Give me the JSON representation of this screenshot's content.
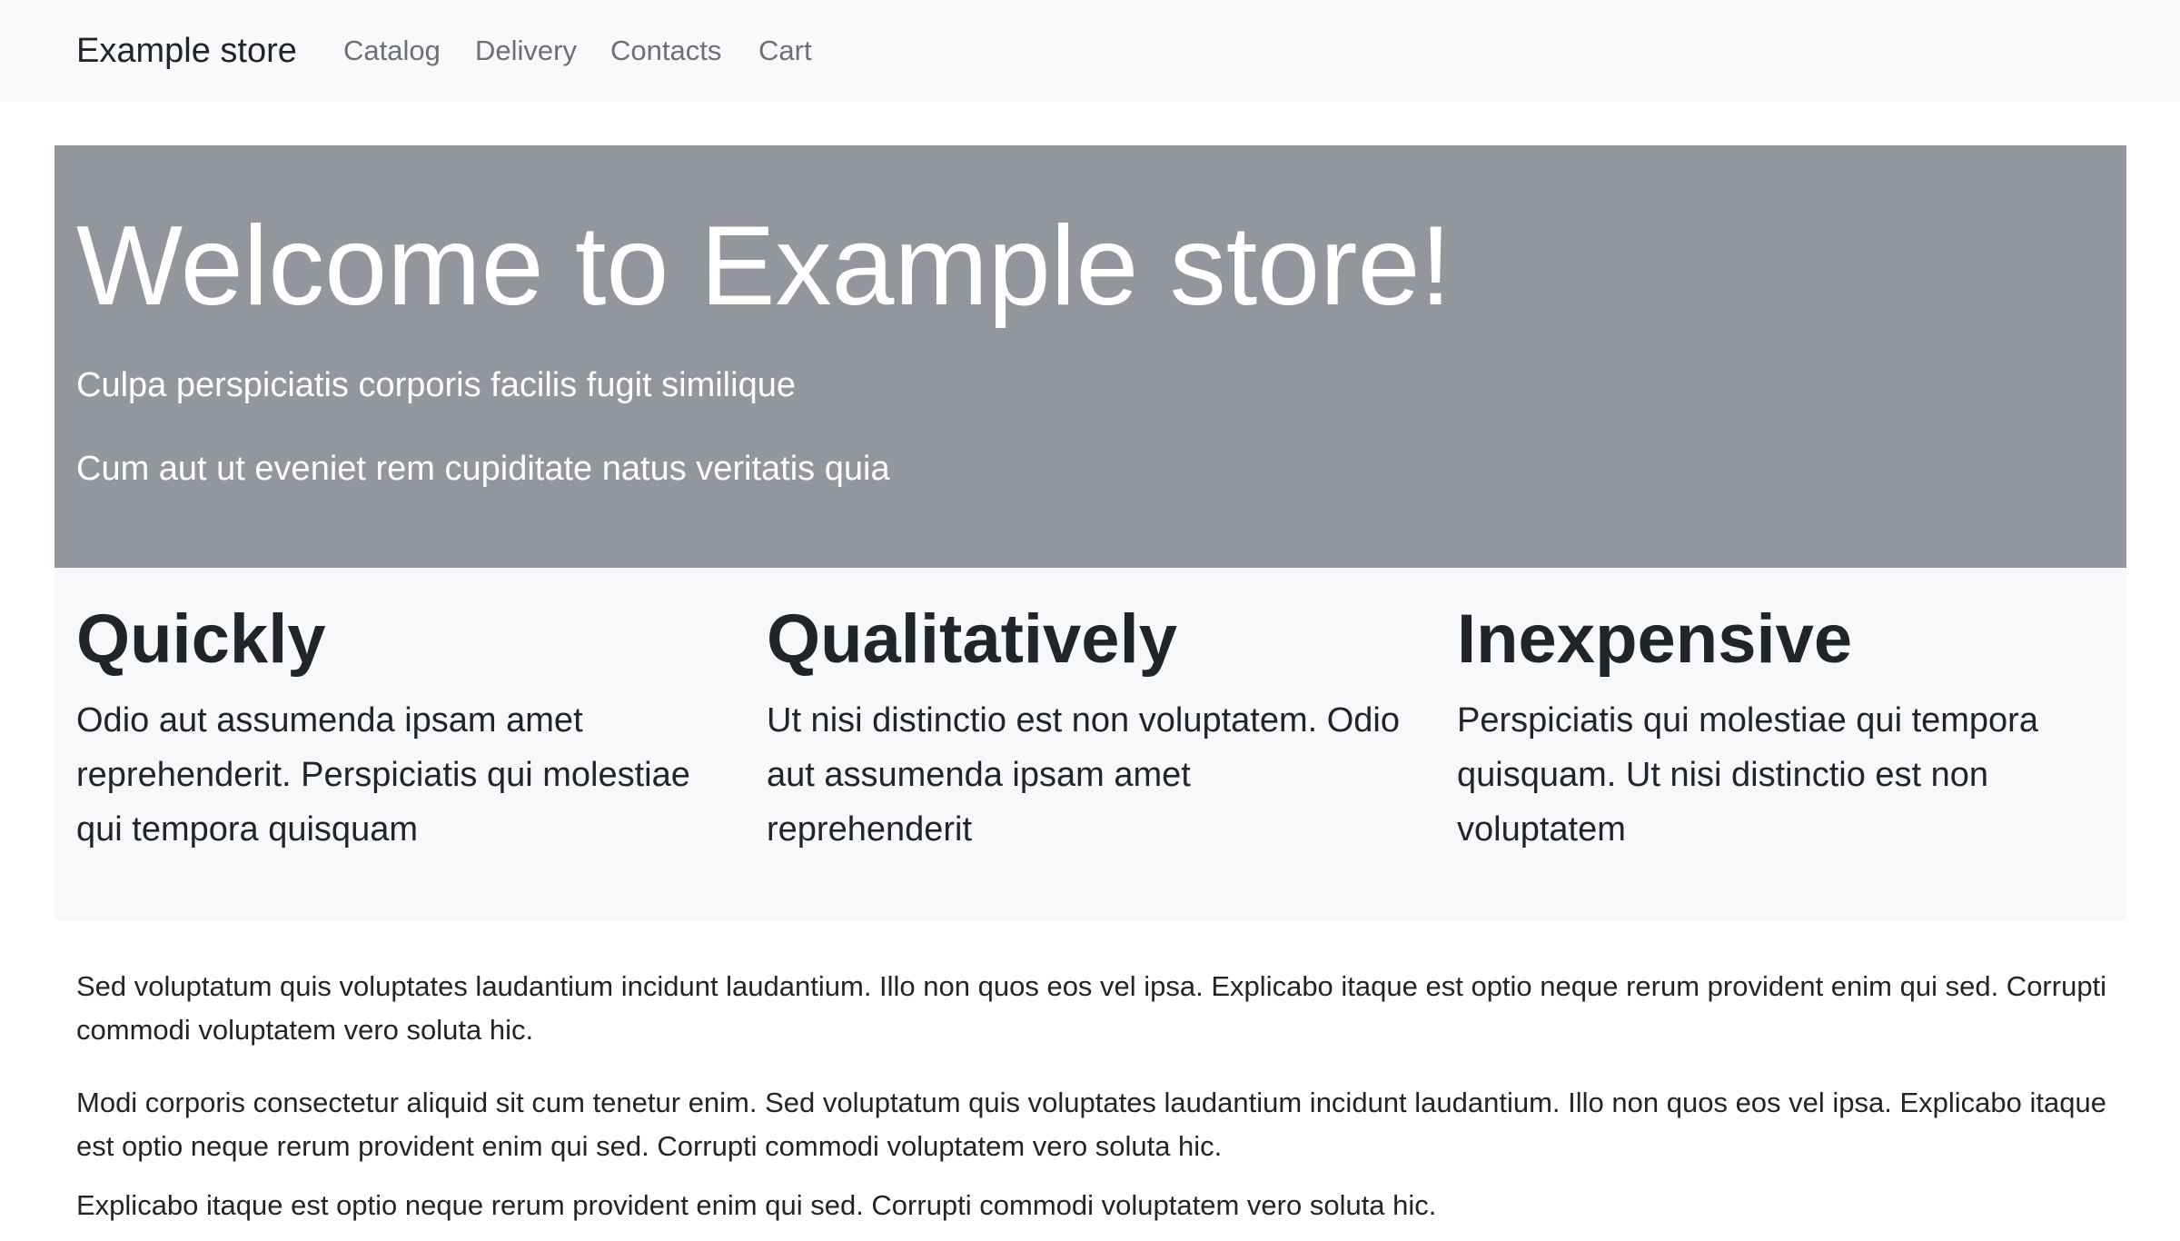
{
  "navbar": {
    "brand": "Example store",
    "links": [
      "Catalog",
      "Delivery",
      "Contacts",
      "Cart"
    ]
  },
  "hero": {
    "title": "Welcome to Example store!",
    "lead1": "Culpa perspiciatis corporis facilis fugit similique",
    "lead2": "Cum aut ut eveniet rem cupiditate natus veritatis quia"
  },
  "features": [
    {
      "title": "Quickly",
      "text": "Odio aut assumenda ipsam amet reprehenderit. Perspiciatis qui molestiae qui tempora quisquam"
    },
    {
      "title": "Qualitatively",
      "text": "Ut nisi distinctio est non voluptatem. Odio aut assumenda ipsam amet reprehenderit"
    },
    {
      "title": "Inexpensive",
      "text": "Perspiciatis qui molestiae qui tempora quisquam. Ut nisi distinctio est non voluptatem"
    }
  ],
  "paragraphs": [
    "Sed voluptatum quis voluptates laudantium incidunt laudantium. Illo non quos eos vel ipsa. Explicabo itaque est optio neque rerum provident enim qui sed. Corrupti commodi voluptatem vero soluta hic.",
    "Modi corporis consectetur aliquid sit cum tenetur enim. Sed voluptatum quis voluptates laudantium incidunt laudantium. Illo non quos eos vel ipsa. Explicabo itaque est optio neque rerum provident enim qui sed. Corrupti commodi voluptatem vero soluta hic.",
    "Explicabo itaque est optio neque rerum provident enim qui sed. Corrupti commodi voluptatem vero soluta hic."
  ],
  "colors": {
    "navbar_bg": "#f8f9fa",
    "hero_bg": "#93979d",
    "features_bg": "#f7f8fa",
    "text": "#212529",
    "nav_link": "#6c6f73"
  }
}
